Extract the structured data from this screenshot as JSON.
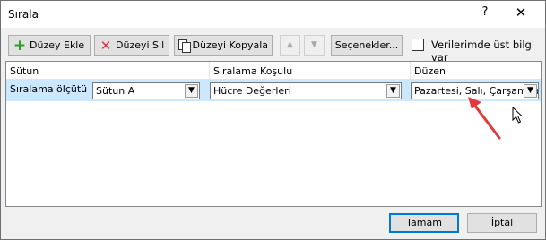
{
  "window": {
    "title": "Sırala",
    "help_label": "?",
    "close_label": "✕"
  },
  "toolbar": {
    "add_level": "Düzey Ekle",
    "delete_level": "Düzeyi Sil",
    "copy_level": "Düzeyi Kopyala",
    "move_up_symbol": "▲",
    "move_down_symbol": "▼",
    "options": "Seçenekler...",
    "headers_checkbox_label": "Verilerimde üst bilgi var",
    "headers_checked": false
  },
  "grid": {
    "headers": {
      "column": "Sütun",
      "sort_on": "Sıralama Koşulu",
      "order": "Düzen"
    },
    "rows": [
      {
        "label": "Sıralama ölçütü",
        "column": "Sütun A",
        "sort_on": "Hücre Değerleri",
        "order": "Pazartesi, Salı, Çarşamba"
      }
    ]
  },
  "footer": {
    "ok": "Tamam",
    "cancel": "İptal"
  },
  "colors": {
    "selected_row": "#cce8ff",
    "annotation_arrow": "#e03a3a",
    "default_button_border": "#0078d7"
  },
  "icons": [
    "plus-icon",
    "delete-x-icon",
    "copy-icon",
    "chevron-down-icon",
    "mouse-cursor-icon"
  ]
}
